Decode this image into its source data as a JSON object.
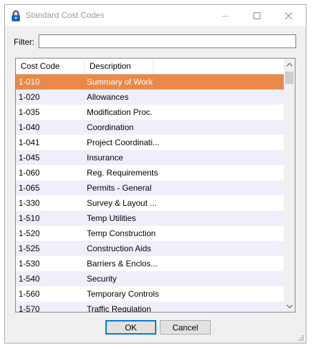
{
  "window": {
    "title": "Standard Cost Codes"
  },
  "filter": {
    "label": "Filter:",
    "value": ""
  },
  "grid": {
    "columns": [
      "Cost Code",
      "Description"
    ],
    "selected_index": 0,
    "rows": [
      {
        "code": "1-010",
        "desc": "Summary of Work"
      },
      {
        "code": "1-020",
        "desc": "Allowances"
      },
      {
        "code": "1-035",
        "desc": "Modification Proc."
      },
      {
        "code": "1-040",
        "desc": "Coordination"
      },
      {
        "code": "1-041",
        "desc": "Project Coordinati..."
      },
      {
        "code": "1-045",
        "desc": "Insurance"
      },
      {
        "code": "1-060",
        "desc": "Reg. Requirements"
      },
      {
        "code": "1-065",
        "desc": "Permits - General"
      },
      {
        "code": "1-330",
        "desc": "Survey & Layout ..."
      },
      {
        "code": "1-510",
        "desc": "Temp Utilities"
      },
      {
        "code": "1-520",
        "desc": "Temp Construction"
      },
      {
        "code": "1-525",
        "desc": "Construction Aids"
      },
      {
        "code": "1-530",
        "desc": "Barriers & Enclos..."
      },
      {
        "code": "1-540",
        "desc": "Security"
      },
      {
        "code": "1-560",
        "desc": "Temporary Controls"
      },
      {
        "code": "1-570",
        "desc": "Traffic Regulation"
      }
    ]
  },
  "buttons": {
    "ok": "OK",
    "cancel": "Cancel"
  },
  "colors": {
    "selected_row": "#e9894a",
    "alt_row": "#efeffc",
    "ok_border": "#0078d7"
  },
  "icons": {
    "app": "padlock-icon",
    "minimize": "minimize-icon",
    "maximize": "maximize-icon",
    "close": "close-icon"
  }
}
